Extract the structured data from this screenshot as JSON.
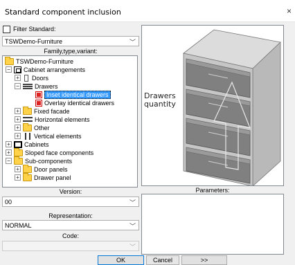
{
  "window": {
    "title": "Standard component inclusion",
    "close_glyph": "×"
  },
  "filter": {
    "label": "Filter Standard:",
    "checked": false
  },
  "standard_select": {
    "value": "TSWDemo-Furniture"
  },
  "family_label": "Family,type,variant:",
  "tree": {
    "root": "TSWDemo-Furniture",
    "cabinet_arrangements": "Cabinet arrangements",
    "doors": "Doors",
    "drawers": "Drawers",
    "inset": "Inset identical drawers",
    "overlay": "Overlay identical drawers",
    "fixed_facade": "Fixed facade",
    "horizontal": "Horizontal elements",
    "other": "Other",
    "vertical": "Vertical elements",
    "cabinets": "Cabinets",
    "sloped": "Sloped face components",
    "subcomponents": "Sub-components",
    "door_panels": "Door panels",
    "drawer_panel": "Drawer panel"
  },
  "preview": {
    "callout_line1": "Drawers",
    "callout_line2": "quantity"
  },
  "version": {
    "label": "Version:",
    "value": "00"
  },
  "representation": {
    "label": "Representation:",
    "value": "NORMAL"
  },
  "code": {
    "label": "Code:",
    "value": ""
  },
  "parameters_label": "Parameters:",
  "buttons": {
    "ok": "OK",
    "cancel": "Cancel",
    "more": ">>"
  },
  "colors": {
    "selection": "#3399ff",
    "folder": "#ffd24a",
    "panel_bg": "#f0f0f0"
  }
}
